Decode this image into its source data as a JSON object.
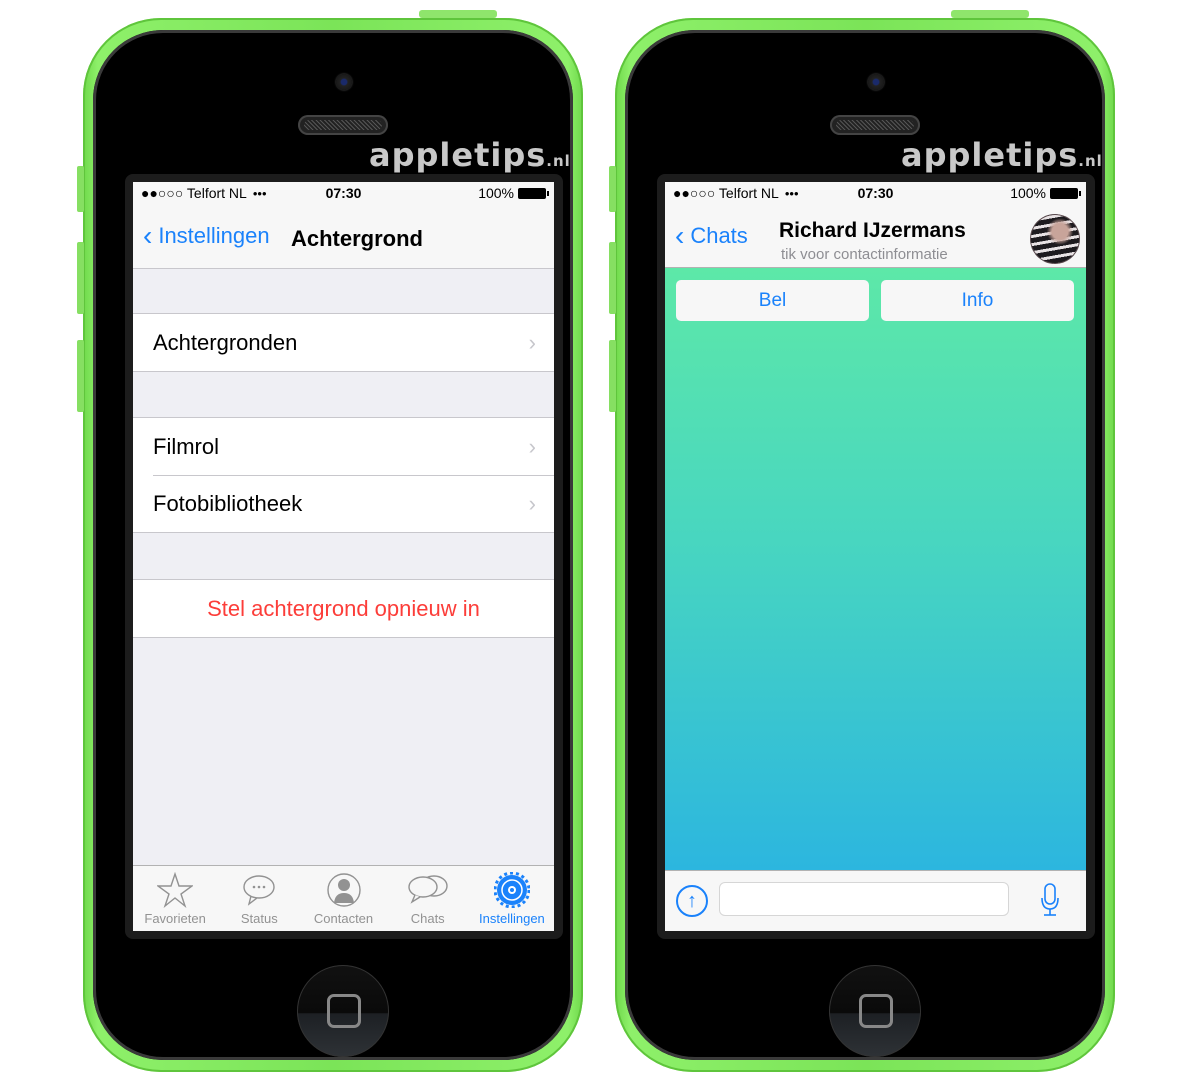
{
  "brand": {
    "name": "appletips",
    "suffix": ".nl"
  },
  "status_bar": {
    "carrier": "Telfort NL",
    "signal": "●●○○○",
    "time": "07:30",
    "battery": "100%"
  },
  "left_screen": {
    "nav": {
      "back_label": "Instellingen",
      "title": "Achtergrond"
    },
    "groups": [
      {
        "items": [
          {
            "label": "Achtergronden"
          }
        ]
      },
      {
        "items": [
          {
            "label": "Filmrol"
          },
          {
            "label": "Fotobibliotheek"
          }
        ]
      },
      {
        "items": [
          {
            "label": "Stel achtergrond opnieuw in"
          }
        ]
      }
    ],
    "tabs": [
      {
        "label": "Favorieten",
        "icon": "star-icon"
      },
      {
        "label": "Status",
        "icon": "speech-bubble-icon"
      },
      {
        "label": "Contacten",
        "icon": "person-icon"
      },
      {
        "label": "Chats",
        "icon": "chats-icon"
      },
      {
        "label": "Instellingen",
        "icon": "gear-icon",
        "active": true
      }
    ],
    "accent": "#1a82fb",
    "danger": "#fc3d39"
  },
  "right_screen": {
    "nav": {
      "back_label": "Chats",
      "contact_name": "Richard IJzermans",
      "subtitle": "tik voor contactinformatie"
    },
    "buttons": {
      "call": "Bel",
      "info": "Info"
    },
    "message_input": {
      "value": "",
      "placeholder": ""
    }
  }
}
